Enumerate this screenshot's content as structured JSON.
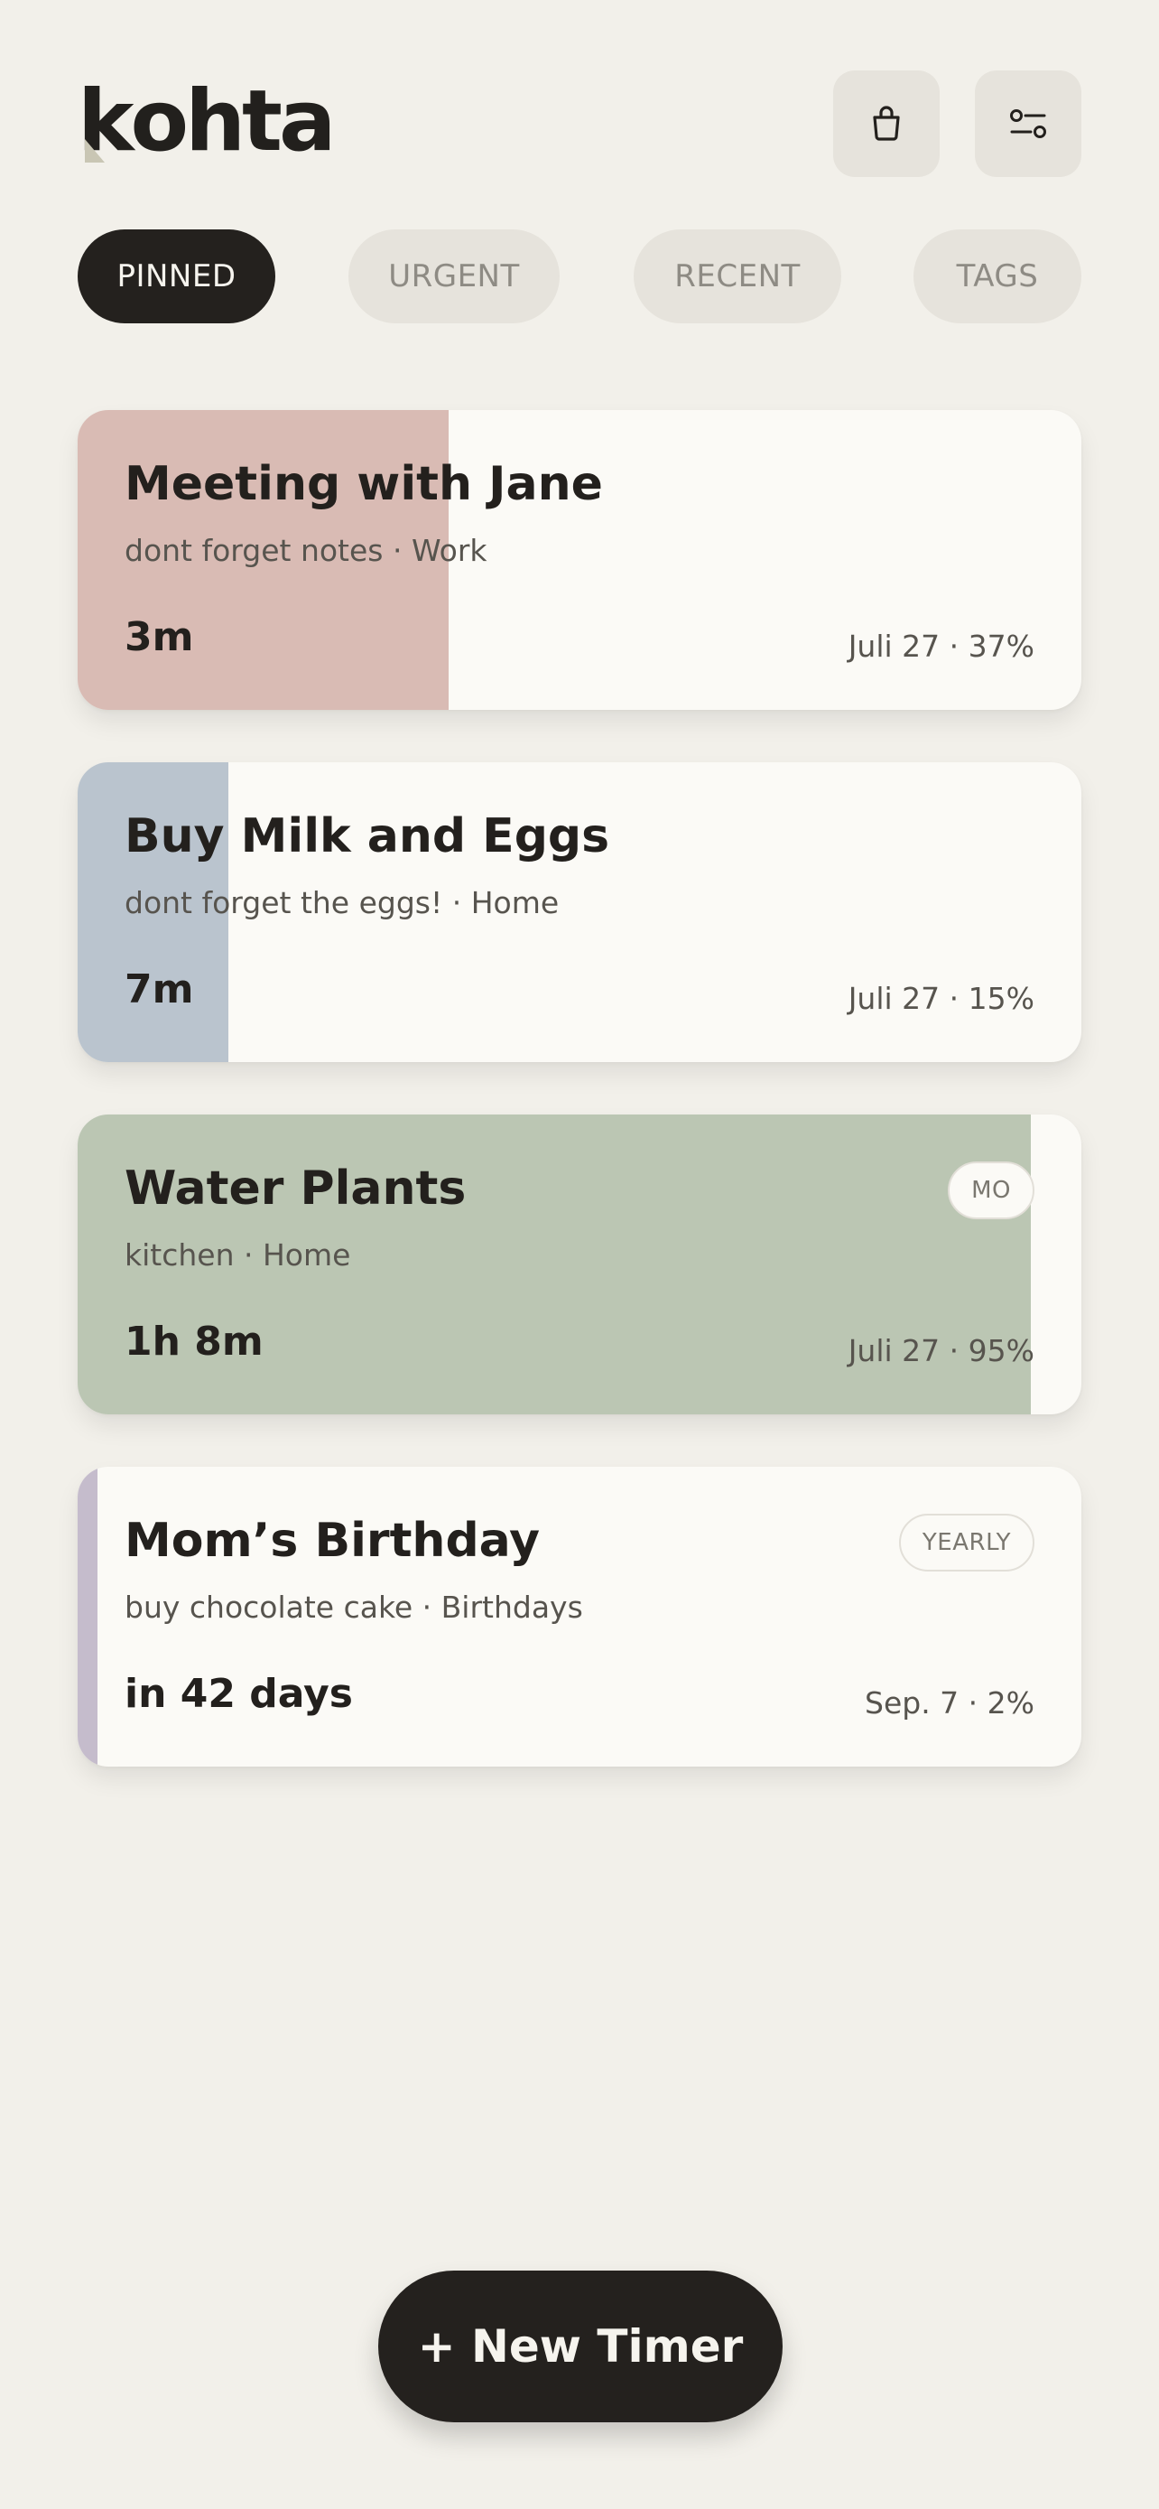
{
  "app": {
    "logo_first_letter": "k",
    "logo_rest": "ohta"
  },
  "header": {
    "bag_icon": "shopping-bag-icon",
    "filter_icon": "filter-toggle-icon"
  },
  "tabs": [
    {
      "label": "PINNED",
      "active": true
    },
    {
      "label": "URGENT",
      "active": false
    },
    {
      "label": "RECENT",
      "active": false
    },
    {
      "label": "TAGS",
      "active": false
    }
  ],
  "timers": [
    {
      "title": "Meeting with Jane",
      "subtitle": "dont forget notes · Work",
      "time_left": "3m",
      "meta": "Juli 27 · 37%",
      "progress": 0.37,
      "color": "#d9bbb4",
      "badge": ""
    },
    {
      "title": "Buy Milk and Eggs",
      "subtitle": "dont forget the eggs! · Home",
      "time_left": "7m",
      "meta": "Juli 27 · 15%",
      "progress": 0.15,
      "color": "#bac4ce",
      "badge": ""
    },
    {
      "title": "Water Plants",
      "subtitle": "kitchen · Home",
      "time_left": "1h 8m",
      "meta": "Juli 27 · 95%",
      "progress": 0.95,
      "color": "#bbc6b3",
      "badge": "MO"
    },
    {
      "title": "Mom’s Birthday",
      "subtitle": "buy chocolate cake · Birthdays",
      "time_left": "in 42 days",
      "meta": "Sep. 7 · 2%",
      "progress": 0.02,
      "color": "#c5bccc",
      "badge": "YEARLY"
    }
  ],
  "actions": {
    "new_timer_label": "+ New Timer"
  },
  "colors": {
    "background": "#f2f0ea",
    "dark": "#24211e",
    "card": "#fbfaf6"
  }
}
